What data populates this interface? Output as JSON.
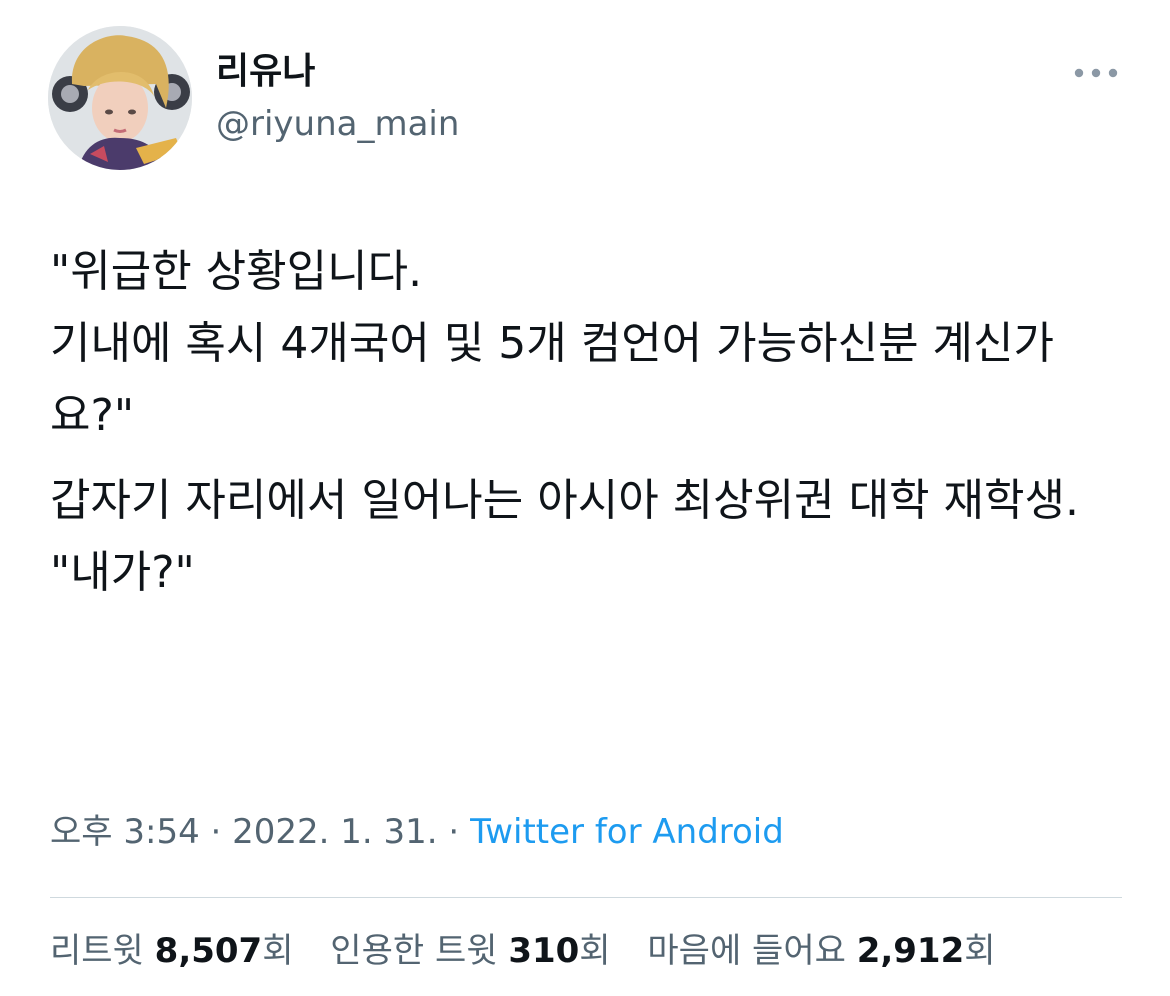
{
  "author": {
    "display_name": "리유나",
    "handle": "@riyuna_main"
  },
  "icons": {
    "more": "more-horizontal-icon",
    "avatar": "profile-avatar"
  },
  "colors": {
    "text": "#0f1419",
    "secondary": "#536471",
    "link": "#1d9bf0",
    "divider": "#cfd9de"
  },
  "tweet": {
    "paragraphs": [
      "\"위급한 상황입니다.\n기내에 혹시 4개국어 및 5개 컴언어 가능하신분 계신가요?\"",
      "갑자기 자리에서 일어나는 아시아 최상위권 대학 재학생.\n\"내가?\""
    ]
  },
  "meta": {
    "time": "오후 3:54",
    "separator": " · ",
    "date": "2022. 1. 31.",
    "separator2": " · ",
    "source": "Twitter for Android"
  },
  "stats": {
    "retweets": {
      "label": "리트윗 ",
      "value": "8,507",
      "unit": "회"
    },
    "quotes": {
      "label": "인용한 트윗 ",
      "value": "310",
      "unit": "회"
    },
    "likes": {
      "label": "마음에 들어요 ",
      "value": "2,912",
      "unit": "회"
    }
  }
}
